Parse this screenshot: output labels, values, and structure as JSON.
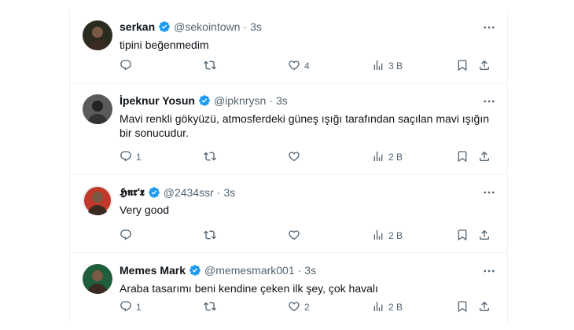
{
  "posts": [
    {
      "name": "serkan",
      "handle": "@sekointown",
      "dot": "·",
      "time": "3s",
      "text": "tipini beğenmedim",
      "replies": "",
      "reposts": "",
      "likes": "4",
      "views": "3 B",
      "avatar_color": "#2b2b1f"
    },
    {
      "name": "İpeknur Yosun",
      "handle": "@ipknrysn",
      "dot": "·",
      "time": "3s",
      "text": "Mavi renkli gökyüzü, atmosferdeki güneş ışığı tarafından saçılan mavi ışığın bir sonucudur.",
      "replies": "1",
      "reposts": "",
      "likes": "",
      "views": "2 B",
      "avatar_color": "#5a5a5a"
    },
    {
      "name": "𝕳𝖓𝖗'𝖝",
      "handle": "@2434ssr",
      "dot": "·",
      "time": "3s",
      "text": "Very good",
      "replies": "",
      "reposts": "",
      "likes": "",
      "views": "2 B",
      "avatar_color": "#c0392b"
    },
    {
      "name": "Memes Mark",
      "handle": "@memesmark001",
      "dot": "·",
      "time": "3s",
      "text": "Araba tasarımı beni kendine çeken ilk şey, çok havalı",
      "replies": "1",
      "reposts": "",
      "likes": "2",
      "views": "2 B",
      "avatar_color": "#1f5e3a"
    }
  ],
  "icons": {
    "more": "more-icon",
    "reply": "reply-icon",
    "repost": "repost-icon",
    "like": "like-icon",
    "views": "views-icon",
    "bookmark": "bookmark-icon",
    "share": "share-icon",
    "verified": "verified-badge-icon"
  },
  "colors": {
    "verified": "#1d9bf0",
    "muted": "#536471",
    "border": "#eff3f4"
  }
}
